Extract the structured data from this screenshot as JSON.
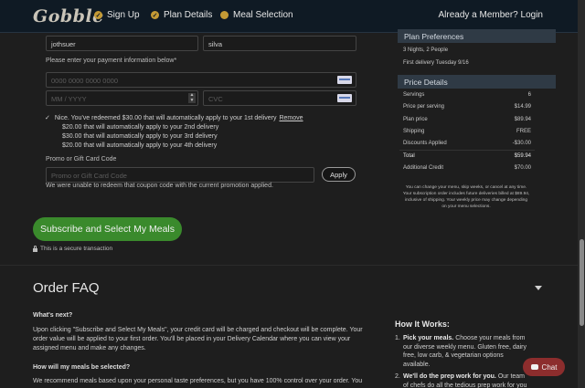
{
  "header": {
    "logo": "Gobble",
    "steps": [
      {
        "label": "Sign Up",
        "state": "done"
      },
      {
        "label": "Plan Details",
        "state": "done"
      },
      {
        "label": "Meal Selection",
        "state": "current"
      }
    ],
    "member_link": "Already a Member? Login"
  },
  "form": {
    "first_name_value": "jothsuer",
    "last_name_value": "silva",
    "payment_label": "Please enter your payment information below*",
    "card_number_placeholder": "0000 0000 0000 0000",
    "expiry_placeholder": "MM / YYYY",
    "cvc_placeholder": "CVC",
    "redeemed_text": "Nice. You've redeemed $30.00 that will automatically apply to your 1st delivery",
    "remove_link": "Remove",
    "credit_lines": [
      "$20.00 that will automatically apply to your 2nd delivery",
      "$30.00 that will automatically apply to your 3rd delivery",
      "$20.00 that will automatically apply to your 4th delivery"
    ],
    "promo_label": "Promo or Gift Card Code",
    "promo_placeholder": "Promo or Gift Card Code",
    "apply_label": "Apply",
    "promo_error": "We were unable to redeem that coupon code with the current promotion applied.",
    "subscribe_label": "Subscribe and Select My Meals",
    "secure_text": "This is a secure transaction"
  },
  "plan_preferences": {
    "heading": "Plan Preferences",
    "lines": [
      "3 Nights, 2 People",
      "First delivery Tuesday 9/16"
    ]
  },
  "price_details": {
    "heading": "Price Details",
    "rows": [
      {
        "label": "Servings",
        "value": "6"
      },
      {
        "label": "Price per serving",
        "value": "$14.99"
      },
      {
        "label": "Plan price",
        "value": "$89.94"
      },
      {
        "label": "Shipping",
        "value": "FREE"
      },
      {
        "label": "Discounts Applied",
        "value": "-$30.00"
      },
      {
        "label": "Total",
        "value": "$59.94"
      },
      {
        "label": "Additional Credit",
        "value": "$70.00"
      }
    ],
    "note": "You can change your menu, skip weeks, or cancel at any time. Your subscription order includes future deliveries billed at $89.94, inclusive of shipping. Your weekly price may change depending on your menu selections."
  },
  "faq": {
    "title": "Order FAQ",
    "items": [
      {
        "q": "What's next?",
        "a": "Upon clicking \"Subscribe and Select My Meals\", your credit card will be charged and checkout will be complete. Your order value will be applied to your first order. You'll be placed in your Delivery Calendar where you can view your assigned menu and make any changes."
      },
      {
        "q": "How will my meals be selected?",
        "a": "We recommend meals based upon your personal taste preferences, but you have 100% control over your order. You can"
      }
    ]
  },
  "how_it_works": {
    "title": "How It Works:",
    "items": [
      {
        "num": "1.",
        "bold": "Pick your meals.",
        "text": " Choose your meals from our diverse weekly menu. Gluten free, dairy free, low carb, & vegetarian options available."
      },
      {
        "num": "2.",
        "bold": "We'll do the prep work for you.",
        "text": " Our team of chefs do all the tedious prep work for you"
      }
    ]
  },
  "chat": {
    "label": "Chat"
  },
  "colors": {
    "accent_gold": "#c49a35",
    "subscribe_green": "#3a8a2c",
    "chat_red": "#8c2d2d"
  }
}
